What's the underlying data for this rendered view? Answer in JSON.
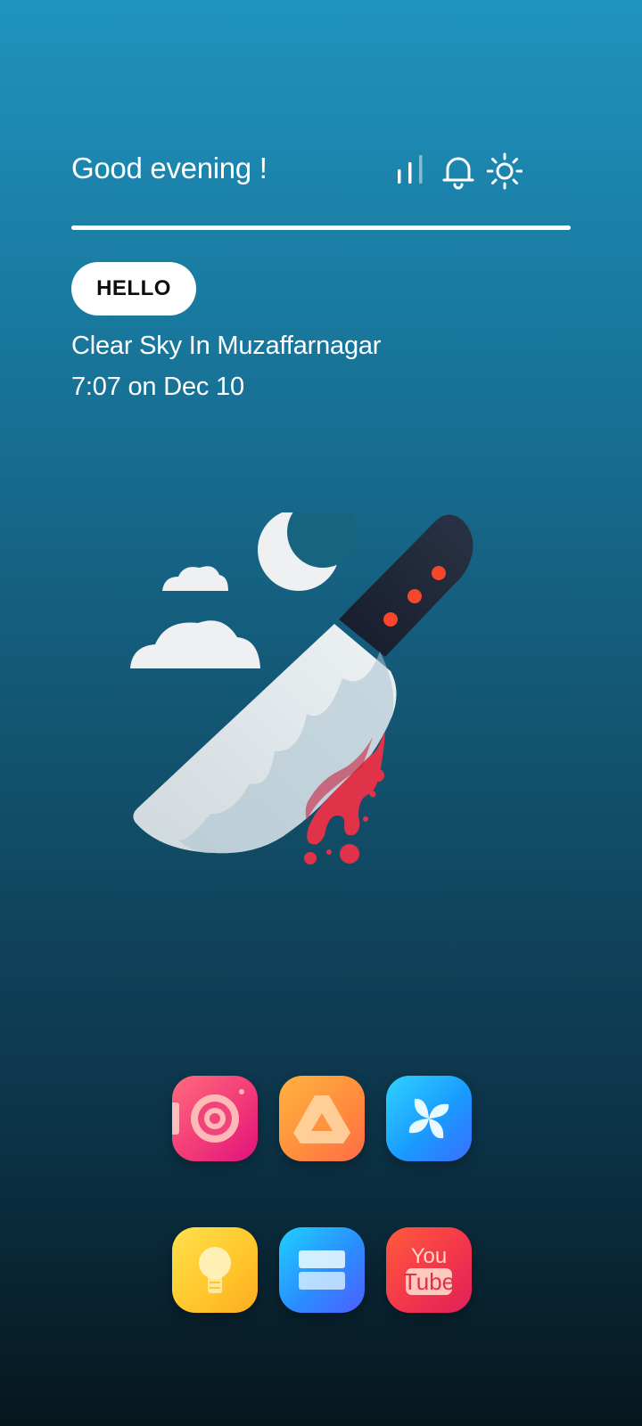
{
  "header": {
    "greeting": "Good evening !",
    "icons": [
      "signal-icon",
      "bell-icon",
      "sun-icon"
    ]
  },
  "widget": {
    "hello_label": "HELLO",
    "weather_text": "Clear Sky In Muzaffarnagar",
    "datetime_text": "7:07 on Dec 10"
  },
  "illustration": {
    "name": "bloody-knife-with-moon-and-clouds"
  },
  "apps": [
    {
      "name": "camera-app-icon",
      "icon": "camera-target-icon"
    },
    {
      "name": "drive-app-icon",
      "icon": "drive-triangle-icon"
    },
    {
      "name": "pinwheel-app-icon",
      "icon": "pinwheel-icon"
    },
    {
      "name": "lightbulb-app-icon",
      "icon": "lightbulb-icon"
    },
    {
      "name": "stack-app-icon",
      "icon": "stacked-bars-icon"
    },
    {
      "name": "youtube-app-icon",
      "icon": "youtube-icon",
      "line1": "You",
      "line2": "Tube"
    }
  ],
  "colors": {
    "background_top": "#1f93be",
    "background_bottom": "#06161d",
    "blood": "#e0334a",
    "knife_handle": "#1e2636",
    "handle_rivets": "#f4472c"
  }
}
